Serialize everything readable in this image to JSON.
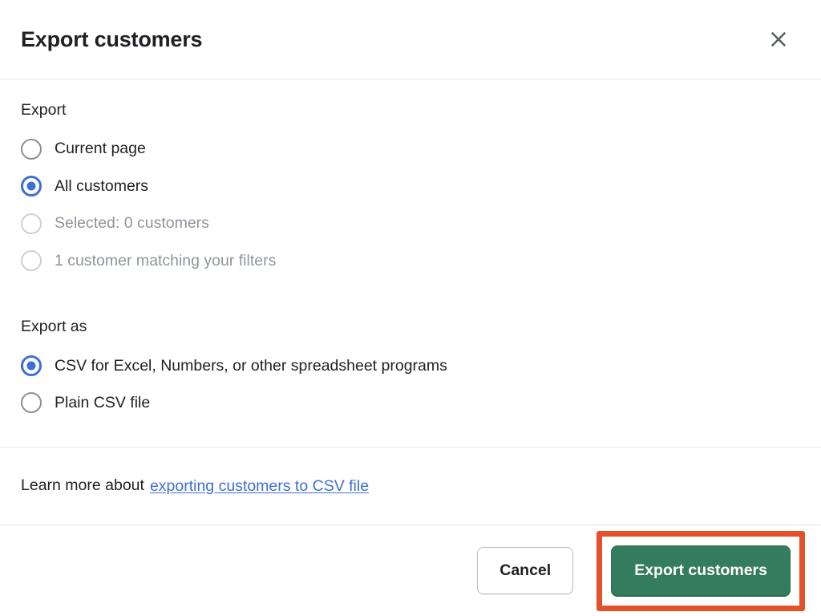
{
  "modal": {
    "title": "Export customers",
    "close_icon": "close-icon"
  },
  "export_section": {
    "label": "Export",
    "options": [
      {
        "label": "Current page",
        "selected": false,
        "disabled": false
      },
      {
        "label": "All customers",
        "selected": true,
        "disabled": false
      },
      {
        "label": "Selected: 0 customers",
        "selected": false,
        "disabled": true
      },
      {
        "label": "1 customer matching your filters",
        "selected": false,
        "disabled": true
      }
    ]
  },
  "export_as_section": {
    "label": "Export as",
    "options": [
      {
        "label": "CSV for Excel, Numbers, or other spreadsheet programs",
        "selected": true,
        "disabled": false
      },
      {
        "label": "Plain CSV file",
        "selected": false,
        "disabled": false
      }
    ]
  },
  "learn_more": {
    "text": "Learn more about",
    "link_label": "exporting customers to CSV file"
  },
  "footer": {
    "cancel_label": "Cancel",
    "primary_label": "Export customers"
  },
  "colors": {
    "accent_blue": "#3f6fd1",
    "primary_green": "#347c5e",
    "highlight_orange": "#e4502a",
    "text": "#202223",
    "muted_text": "#8f959b",
    "divider": "#e4e5e7"
  }
}
